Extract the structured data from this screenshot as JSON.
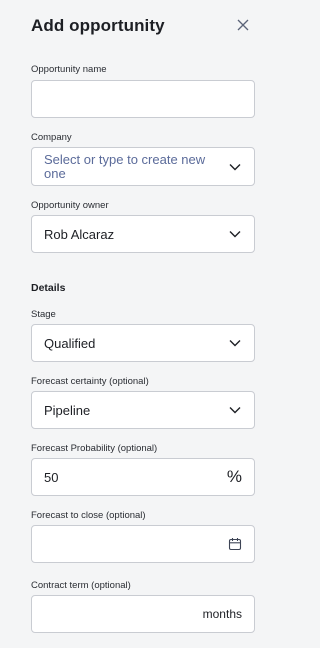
{
  "dialog": {
    "title": "Add opportunity"
  },
  "fields": {
    "opportunity_name": {
      "label": "Opportunity name",
      "value": ""
    },
    "company": {
      "label": "Company",
      "placeholder": "Select or type to create new one"
    },
    "owner": {
      "label": "Opportunity owner",
      "value": "Rob Alcaraz"
    },
    "details_heading": "Details",
    "stage": {
      "label": "Stage",
      "value": "Qualified"
    },
    "forecast_certainty": {
      "label": "Forecast certainty (optional)",
      "value": "Pipeline"
    },
    "forecast_probability": {
      "label": "Forecast Probability (optional)",
      "value": "50",
      "suffix": "%"
    },
    "forecast_close": {
      "label": "Forecast to close (optional)",
      "value": ""
    },
    "contract_term": {
      "label": "Contract term (optional)",
      "value": "",
      "suffix": "months"
    }
  },
  "icons": {
    "close": "close-icon",
    "dropdown": "chevron-down-icon",
    "calendar": "calendar-icon"
  },
  "colors": {
    "background": "#f4f5f6",
    "border": "#c9ccd2",
    "placeholder": "#5b6b9a",
    "text": "#1d1f24"
  }
}
